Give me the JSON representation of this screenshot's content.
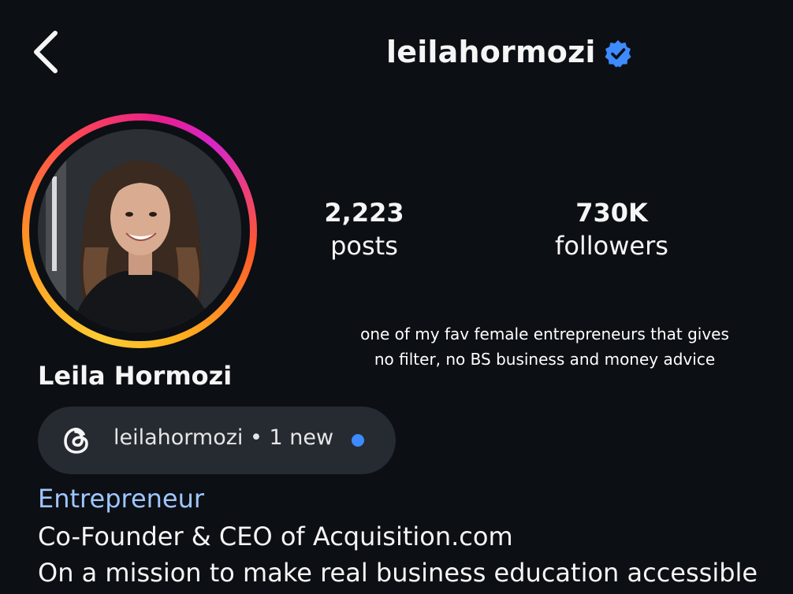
{
  "header": {
    "username": "leilahormozi",
    "verified": true,
    "back_icon": "chevron-left-icon",
    "verified_icon": "verified-badge-icon",
    "verified_color": "#3d8bff"
  },
  "profile": {
    "avatar_alt": "avatar",
    "full_name": "Leila Hormozi"
  },
  "stats": {
    "posts_value": "2,223",
    "posts_label": "posts",
    "followers_value": "730K",
    "followers_label": "followers"
  },
  "caption": {
    "line1": "one of my fav female entrepreneurs that gives",
    "line2": "no filter, no BS business and money advice"
  },
  "threads": {
    "icon": "threads-icon",
    "handle": "leilahormozi",
    "separator": "•",
    "new_label": "1 new",
    "dot_color": "#3d8bff"
  },
  "bio": {
    "category": "Entrepreneur",
    "line1": "Co-Founder & CEO of Acquisition.com",
    "line2": "On a mission to make real business education accessible"
  },
  "colors": {
    "background": "#0c0f14",
    "category_text": "#9fc6ff",
    "pill_bg": "#262a31"
  }
}
